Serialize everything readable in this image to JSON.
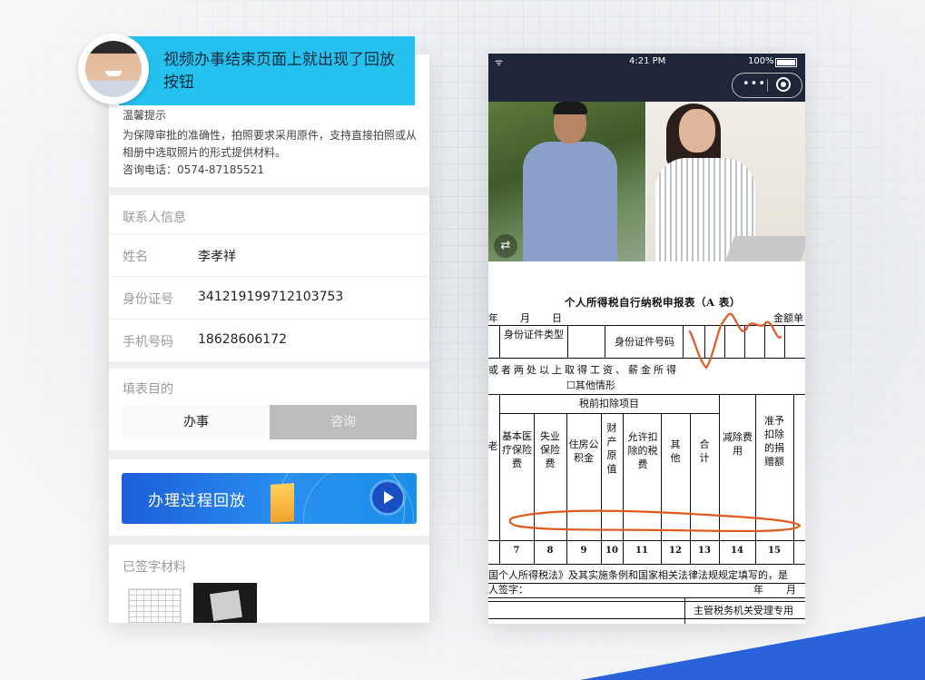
{
  "callout": {
    "text": "视频办事结束页面上就出现了回放按钮"
  },
  "left_panel": {
    "tips": {
      "title": "温馨提示",
      "body": "为保障审批的准确性，拍照要求采用原件，支持直接拍照或从相册中选取照片的形式提供材料。",
      "phone": "咨询电话：0574-87185521"
    },
    "contact": {
      "section_title": "联系人信息",
      "rows": [
        {
          "label": "姓名",
          "value": "李孝祥"
        },
        {
          "label": "身份证号",
          "value": "341219199712103753"
        },
        {
          "label": "手机号码",
          "value": "18628606172"
        }
      ]
    },
    "purpose": {
      "section_title": "填表目的",
      "options": [
        "办事",
        "咨询"
      ],
      "selected": "办事"
    },
    "replay_button_label": "办理过程回放",
    "signed": {
      "section_title": "已签字材料"
    }
  },
  "right_phone": {
    "status": {
      "time": "4:21 PM",
      "battery": "100%"
    },
    "capsule": {
      "dots": "•••"
    },
    "form": {
      "title": "个人所得税自行纳税申报表（A 表）",
      "date_line": [
        "年",
        "月",
        "日"
      ],
      "amount_unit": "金额单",
      "id_type_label": "身份证件类型",
      "id_number_label": "身份证件号码",
      "line_two_places": "或者两处以上取得工资、薪金所得",
      "other_case": "☐其他情形",
      "pre_tax_deduction": "税前扣除项目",
      "old_partial": "老",
      "col_headers": [
        "基本医疗保险费",
        "失业保险费",
        "住房公积金",
        "财产原值",
        "允许扣除的税费",
        "其他",
        "合计",
        "减除费用",
        "准予扣除的捐赠额"
      ],
      "col_numbers": [
        "7",
        "8",
        "9",
        "10",
        "11",
        "12",
        "13",
        "14",
        "15"
      ],
      "declaration": "国个人所得税法》及其实施条例和国家相关法律法规规定填写的，是",
      "signature": "人签字：",
      "sig_date": [
        "年",
        "月"
      ],
      "tax_office": "主管税务机关受理专用"
    }
  },
  "colors": {
    "callout_bg": "#26c2ef",
    "status_bar": "#20263a",
    "replay_gradient_start": "#1c5ed8",
    "pen_mark": "#e05a1f"
  }
}
